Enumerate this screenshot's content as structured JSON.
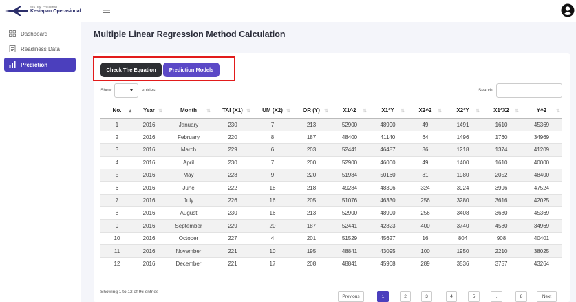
{
  "header": {
    "logo_small": "SISTEM PREDIKSI",
    "logo_big": "Kesiapan Operasional"
  },
  "sidebar": {
    "items": [
      {
        "label": "Dashboard",
        "icon": "grid-icon"
      },
      {
        "label": "Readiness Data",
        "icon": "document-icon"
      },
      {
        "label": "Prediction",
        "icon": "bar-chart-icon",
        "active": true
      }
    ]
  },
  "main": {
    "title": "Multiple Linear Regression Method Calculation",
    "buttons": {
      "check_equation": "Check The Equation",
      "prediction_models": "Prediction Models"
    },
    "highlight_color": "#e21b1b",
    "show_label": "Show",
    "entries_label": "entries",
    "search_label": "Search:",
    "search_value": "",
    "columns": [
      "No.",
      "Year",
      "Month",
      "TAI (X1)",
      "UM (X2)",
      "OR (Y)",
      "X1^2",
      "X1*Y",
      "X2^2",
      "X2*Y",
      "X1*X2",
      "Y^2"
    ],
    "rows": [
      [
        "1",
        "2016",
        "January",
        "230",
        "7",
        "213",
        "52900",
        "48990",
        "49",
        "1491",
        "1610",
        "45369"
      ],
      [
        "2",
        "2016",
        "February",
        "220",
        "8",
        "187",
        "48400",
        "41140",
        "64",
        "1496",
        "1760",
        "34969"
      ],
      [
        "3",
        "2016",
        "March",
        "229",
        "6",
        "203",
        "52441",
        "46487",
        "36",
        "1218",
        "1374",
        "41209"
      ],
      [
        "4",
        "2016",
        "April",
        "230",
        "7",
        "200",
        "52900",
        "46000",
        "49",
        "1400",
        "1610",
        "40000"
      ],
      [
        "5",
        "2016",
        "May",
        "228",
        "9",
        "220",
        "51984",
        "50160",
        "81",
        "1980",
        "2052",
        "48400"
      ],
      [
        "6",
        "2016",
        "June",
        "222",
        "18",
        "218",
        "49284",
        "48396",
        "324",
        "3924",
        "3996",
        "47524"
      ],
      [
        "7",
        "2016",
        "July",
        "226",
        "16",
        "205",
        "51076",
        "46330",
        "256",
        "3280",
        "3616",
        "42025"
      ],
      [
        "8",
        "2016",
        "August",
        "230",
        "16",
        "213",
        "52900",
        "48990",
        "256",
        "3408",
        "3680",
        "45369"
      ],
      [
        "9",
        "2016",
        "September",
        "229",
        "20",
        "187",
        "52441",
        "42823",
        "400",
        "3740",
        "4580",
        "34969"
      ],
      [
        "10",
        "2016",
        "October",
        "227",
        "4",
        "201",
        "51529",
        "45627",
        "16",
        "804",
        "908",
        "40401"
      ],
      [
        "11",
        "2016",
        "November",
        "221",
        "10",
        "195",
        "48841",
        "43095",
        "100",
        "1950",
        "2210",
        "38025"
      ],
      [
        "12",
        "2016",
        "December",
        "221",
        "17",
        "208",
        "48841",
        "45968",
        "289",
        "3536",
        "3757",
        "43264"
      ]
    ],
    "info": "Showing 1 to 12 of 96 entries",
    "pagination": [
      "Previous",
      "1",
      "2",
      "3",
      "4",
      "5",
      "...",
      "8",
      "Next"
    ],
    "active_page": "1"
  },
  "colors": {
    "accent": "#4b3fbd",
    "dark_button": "#2d2f33",
    "purple_button": "#5b49c7"
  }
}
